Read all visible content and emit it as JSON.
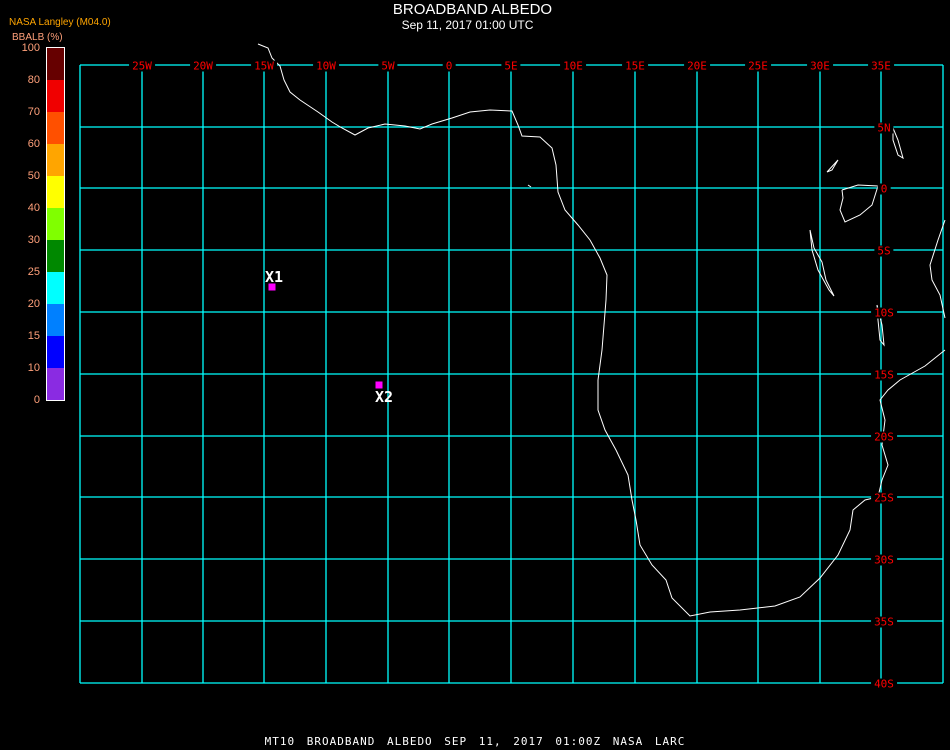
{
  "header": {
    "title": "BROADBAND ALBEDO",
    "subtitle": "Sep 11, 2017 01:00 UTC"
  },
  "legend": {
    "source": "NASA Langley (M04.0)",
    "variable": "BBALB (%)",
    "ticks": [
      "100",
      "80",
      "70",
      "60",
      "50",
      "40",
      "30",
      "25",
      "20",
      "15",
      "10",
      "0"
    ],
    "colors": [
      "#660000",
      "#f00000",
      "#ff5000",
      "#ffa500",
      "#ffff00",
      "#80ff00",
      "#008800",
      "#00ffff",
      "#0080ff",
      "#0000ff",
      "#8a2be2"
    ]
  },
  "map": {
    "grid_color": "#00ffff",
    "label_color": "#ff0000",
    "coast_color": "#ffffff",
    "lon_labels": [
      "25W",
      "20W",
      "15W",
      "10W",
      "5W",
      "0",
      "5E",
      "10E",
      "15E",
      "20E",
      "25E",
      "30E",
      "35E"
    ],
    "lat_labels": [
      "5N",
      "0",
      "5S",
      "10S",
      "15S",
      "20S",
      "25S",
      "30S",
      "35S",
      "40S"
    ],
    "markers": [
      {
        "label": "X1",
        "color": "#ff00ff"
      },
      {
        "label": "X2",
        "color": "#ff00ff"
      }
    ]
  },
  "footer": "MT10  BROADBAND ALBEDO   SEP 11, 2017 01:00Z   NASA LARC"
}
